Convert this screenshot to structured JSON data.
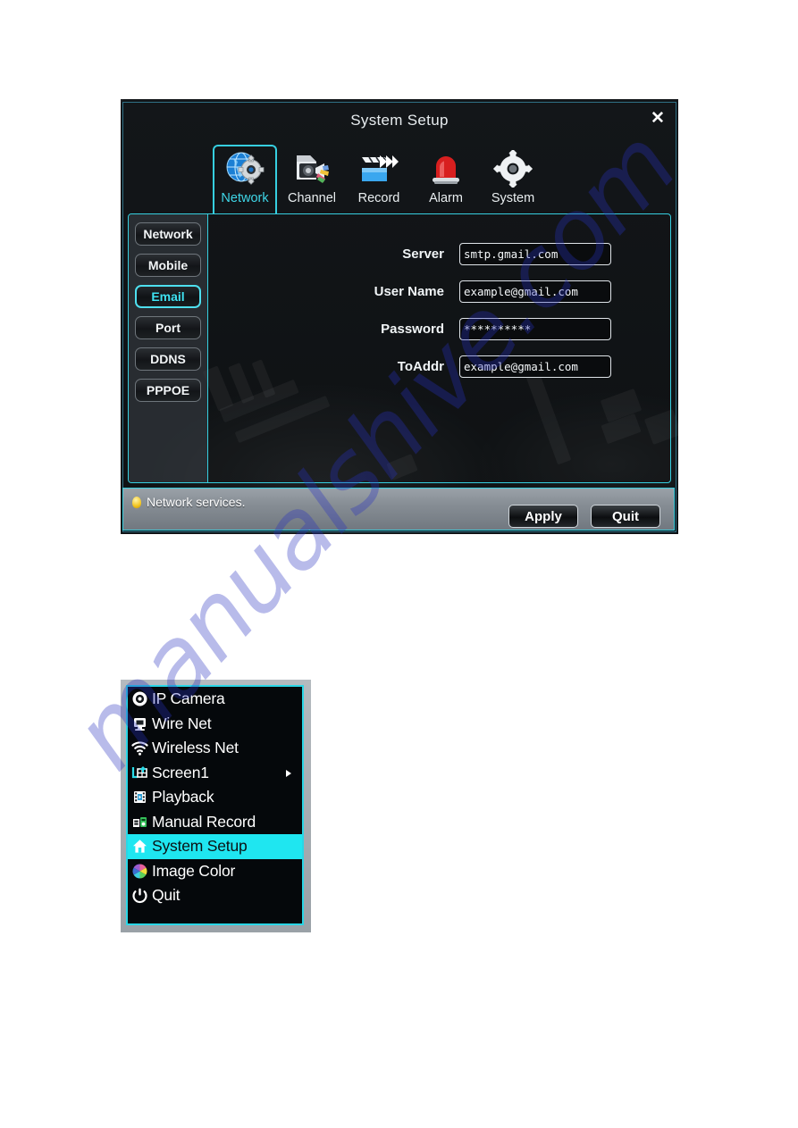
{
  "watermark": {
    "text": "manualshive.com"
  },
  "window": {
    "title": "System Setup",
    "close_label": "✕",
    "tabs": [
      {
        "label": "Network",
        "icon": "globe-gear-icon",
        "active": true
      },
      {
        "label": "Channel",
        "icon": "camera-channel-icon",
        "active": false
      },
      {
        "label": "Record",
        "icon": "clapperboard-icon",
        "active": false
      },
      {
        "label": "Alarm",
        "icon": "siren-icon",
        "active": false
      },
      {
        "label": "System",
        "icon": "gear-icon",
        "active": false
      }
    ],
    "sidebar": {
      "items": [
        {
          "label": "Network",
          "selected": false
        },
        {
          "label": "Mobile",
          "selected": false
        },
        {
          "label": "Email",
          "selected": true
        },
        {
          "label": "Port",
          "selected": false
        },
        {
          "label": "DDNS",
          "selected": false
        },
        {
          "label": "PPPOE",
          "selected": false
        }
      ]
    },
    "form": {
      "fields": [
        {
          "label": "Server",
          "value": "smtp.gmail.com"
        },
        {
          "label": "User Name",
          "value": "example@gmail.com"
        },
        {
          "label": "Password",
          "value": "**********"
        },
        {
          "label": "ToAddr",
          "value": "example@gmail.com"
        }
      ]
    },
    "footer": {
      "hint": "Network services.",
      "apply_label": "Apply",
      "quit_label": "Quit"
    },
    "accent_color": "#36cfe0",
    "highlight_color": "#1fe6f0"
  },
  "context_menu": {
    "items": [
      {
        "label": "IP Camera",
        "icon": "camera-lens-icon",
        "highlighted": false,
        "submenu": false
      },
      {
        "label": "Wire Net",
        "icon": "wired-network-icon",
        "highlighted": false,
        "submenu": false
      },
      {
        "label": "Wireless Net",
        "icon": "wifi-icon",
        "highlighted": false,
        "submenu": false
      },
      {
        "label": "Screen1",
        "icon": "screen-split-icon",
        "highlighted": false,
        "submenu": true
      },
      {
        "label": "Playback",
        "icon": "film-strip-icon",
        "highlighted": false,
        "submenu": false
      },
      {
        "label": "Manual Record",
        "icon": "manual-record-icon",
        "highlighted": false,
        "submenu": false
      },
      {
        "label": "System Setup",
        "icon": "home-icon",
        "highlighted": true,
        "submenu": false
      },
      {
        "label": "Image Color",
        "icon": "color-wheel-icon",
        "highlighted": false,
        "submenu": false
      },
      {
        "label": "Quit",
        "icon": "power-icon",
        "highlighted": false,
        "submenu": false
      }
    ]
  }
}
